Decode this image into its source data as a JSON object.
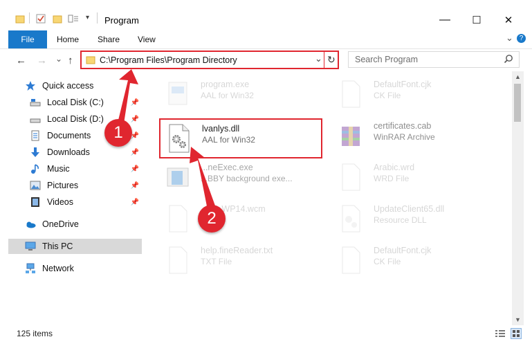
{
  "window": {
    "title": "Program",
    "minimize_glyph": "—",
    "maximize_glyph": "☐",
    "close_glyph": "✕"
  },
  "ribbon": {
    "tabs": [
      "File",
      "Home",
      "Share",
      "View"
    ],
    "collapse_glyph": "⌄",
    "help_glyph": "?"
  },
  "address": {
    "path": "C:\\Program Files\\Program Directory",
    "dropdown_glyph": "⌄",
    "refresh_glyph": "↻"
  },
  "search": {
    "placeholder": "Search Program"
  },
  "nav": {
    "back_glyph": "←",
    "forward_glyph": "→",
    "history_glyph": "⌄",
    "up_glyph": "↑",
    "items": [
      {
        "label": "Quick access",
        "icon": "star-icon",
        "pinned": false
      },
      {
        "label": "Local Disk (C:)",
        "icon": "drive-icon",
        "pinned": true
      },
      {
        "label": "Local Disk (D:)",
        "icon": "drive-icon",
        "pinned": true
      },
      {
        "label": "Documents",
        "icon": "documents-icon",
        "pinned": true
      },
      {
        "label": "Downloads",
        "icon": "download-icon",
        "pinned": true
      },
      {
        "label": "Music",
        "icon": "music-icon",
        "pinned": true
      },
      {
        "label": "Pictures",
        "icon": "pictures-icon",
        "pinned": true
      },
      {
        "label": "Videos",
        "icon": "videos-icon",
        "pinned": true
      },
      {
        "label": "OneDrive",
        "icon": "cloud-icon",
        "pinned": false
      },
      {
        "label": "This PC",
        "icon": "computer-icon",
        "pinned": false,
        "selected": true
      },
      {
        "label": "Network",
        "icon": "network-icon",
        "pinned": false
      }
    ]
  },
  "files": [
    {
      "name": "program.exe",
      "desc": "AAL for Win32",
      "icon": "program-icon"
    },
    {
      "name": "DefaultFont.cjk",
      "desc": "CK File",
      "icon": "blank-file-icon"
    },
    {
      "name": "lvanlys.dll",
      "desc": "AAL for Win32",
      "icon": "dll-gear-icon",
      "highlighted": true
    },
    {
      "name": "certificates.cab",
      "desc": "WinRAR Archive",
      "icon": "archive-icon"
    },
    {
      "name": "...neExec.exe",
      "desc": "...BBY background exe...",
      "icon": "app-icon"
    },
    {
      "name": "Arabic.wrd",
      "desc": "WRD File",
      "icon": "blank-file-icon"
    },
    {
      "name": "...WP14.wcm",
      "desc": "",
      "icon": "blank-file-icon"
    },
    {
      "name": "UpdateClient65.dll",
      "desc": "Resource DLL",
      "icon": "dll-gear-icon"
    },
    {
      "name": "help.fineReader.txt",
      "desc": "TXT File",
      "icon": "text-file-icon"
    },
    {
      "name": "DefaultFont.cjk",
      "desc": "CK File",
      "icon": "blank-file-icon"
    }
  ],
  "status": {
    "item_count": "125 items"
  },
  "annotations": {
    "badge1": "1",
    "badge2": "2"
  },
  "colors": {
    "accent": "#1979ca",
    "highlight": "#e0262f"
  }
}
